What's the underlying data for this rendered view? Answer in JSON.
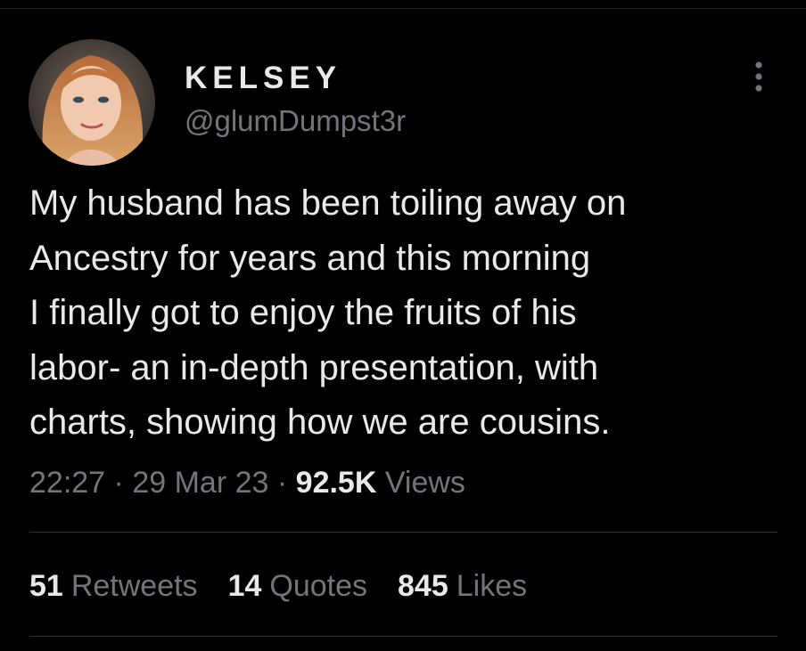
{
  "tweet": {
    "author": {
      "display_name": "KELSEY",
      "handle": "@glumDumpst3r",
      "avatar_icon": "profile-photo"
    },
    "more_icon": "more-options-icon",
    "text_lines": [
      "My husband has been toiling away on",
      "Ancestry for years and this morning",
      "I finally got to enjoy the fruits of his",
      "labor- an in-depth presentation, with",
      "charts, showing how we are cousins."
    ],
    "time": "22:27",
    "separator": "·",
    "date": "29 Mar 23",
    "views_count": "92.5K",
    "views_label": "Views",
    "stats": {
      "retweets_count": "51",
      "retweets_label": "Retweets",
      "quotes_count": "14",
      "quotes_label": "Quotes",
      "likes_count": "845",
      "likes_label": "Likes"
    }
  },
  "colors": {
    "background": "#000000",
    "primary_text": "#e7e9ea",
    "secondary_text": "#71767b",
    "divider": "#2f3336"
  }
}
